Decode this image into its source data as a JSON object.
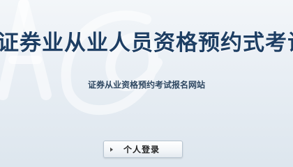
{
  "header": {
    "title": "证券业从业人员资格预约式考试网",
    "subtitle": "证券从业资格预约考试报名网站"
  },
  "login": {
    "label": "个人登录",
    "icon": "arrow-right-icon"
  },
  "colors": {
    "title": "#1d3e63",
    "subtitle": "#2f4862",
    "background": "#e8eef4"
  }
}
